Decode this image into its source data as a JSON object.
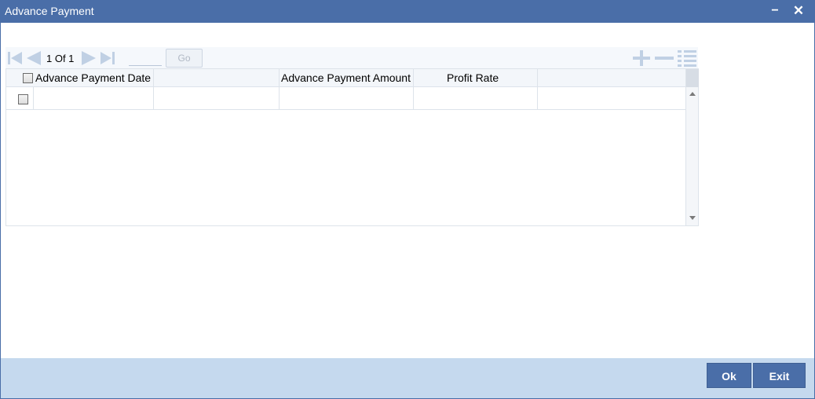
{
  "window": {
    "title": "Advance Payment",
    "minimize_symbol": "−",
    "close_symbol": "✕"
  },
  "pager": {
    "current_page": "1",
    "of_label": "Of",
    "total_pages": "1",
    "page_text": "1 Of 1",
    "page_input_value": "",
    "go_label": "Go",
    "icons": [
      "first-page-icon",
      "previous-page-icon",
      "next-page-icon",
      "last-page-icon"
    ]
  },
  "toolbar_icons": [
    "add-row-icon",
    "delete-row-icon",
    "single-view-icon"
  ],
  "table": {
    "columns": [
      "Advance Payment Date",
      "",
      "Advance Payment Amount",
      "Profit Rate",
      ""
    ],
    "rows": [
      [
        "",
        "",
        "",
        "",
        ""
      ]
    ]
  },
  "footer": {
    "ok_label": "Ok",
    "exit_label": "Exit"
  },
  "colors": {
    "titlebar": "#4a6ea8",
    "footer": "#c5d9ee",
    "button": "#4a6ea8",
    "nav_icon": "#c0d0e4"
  }
}
